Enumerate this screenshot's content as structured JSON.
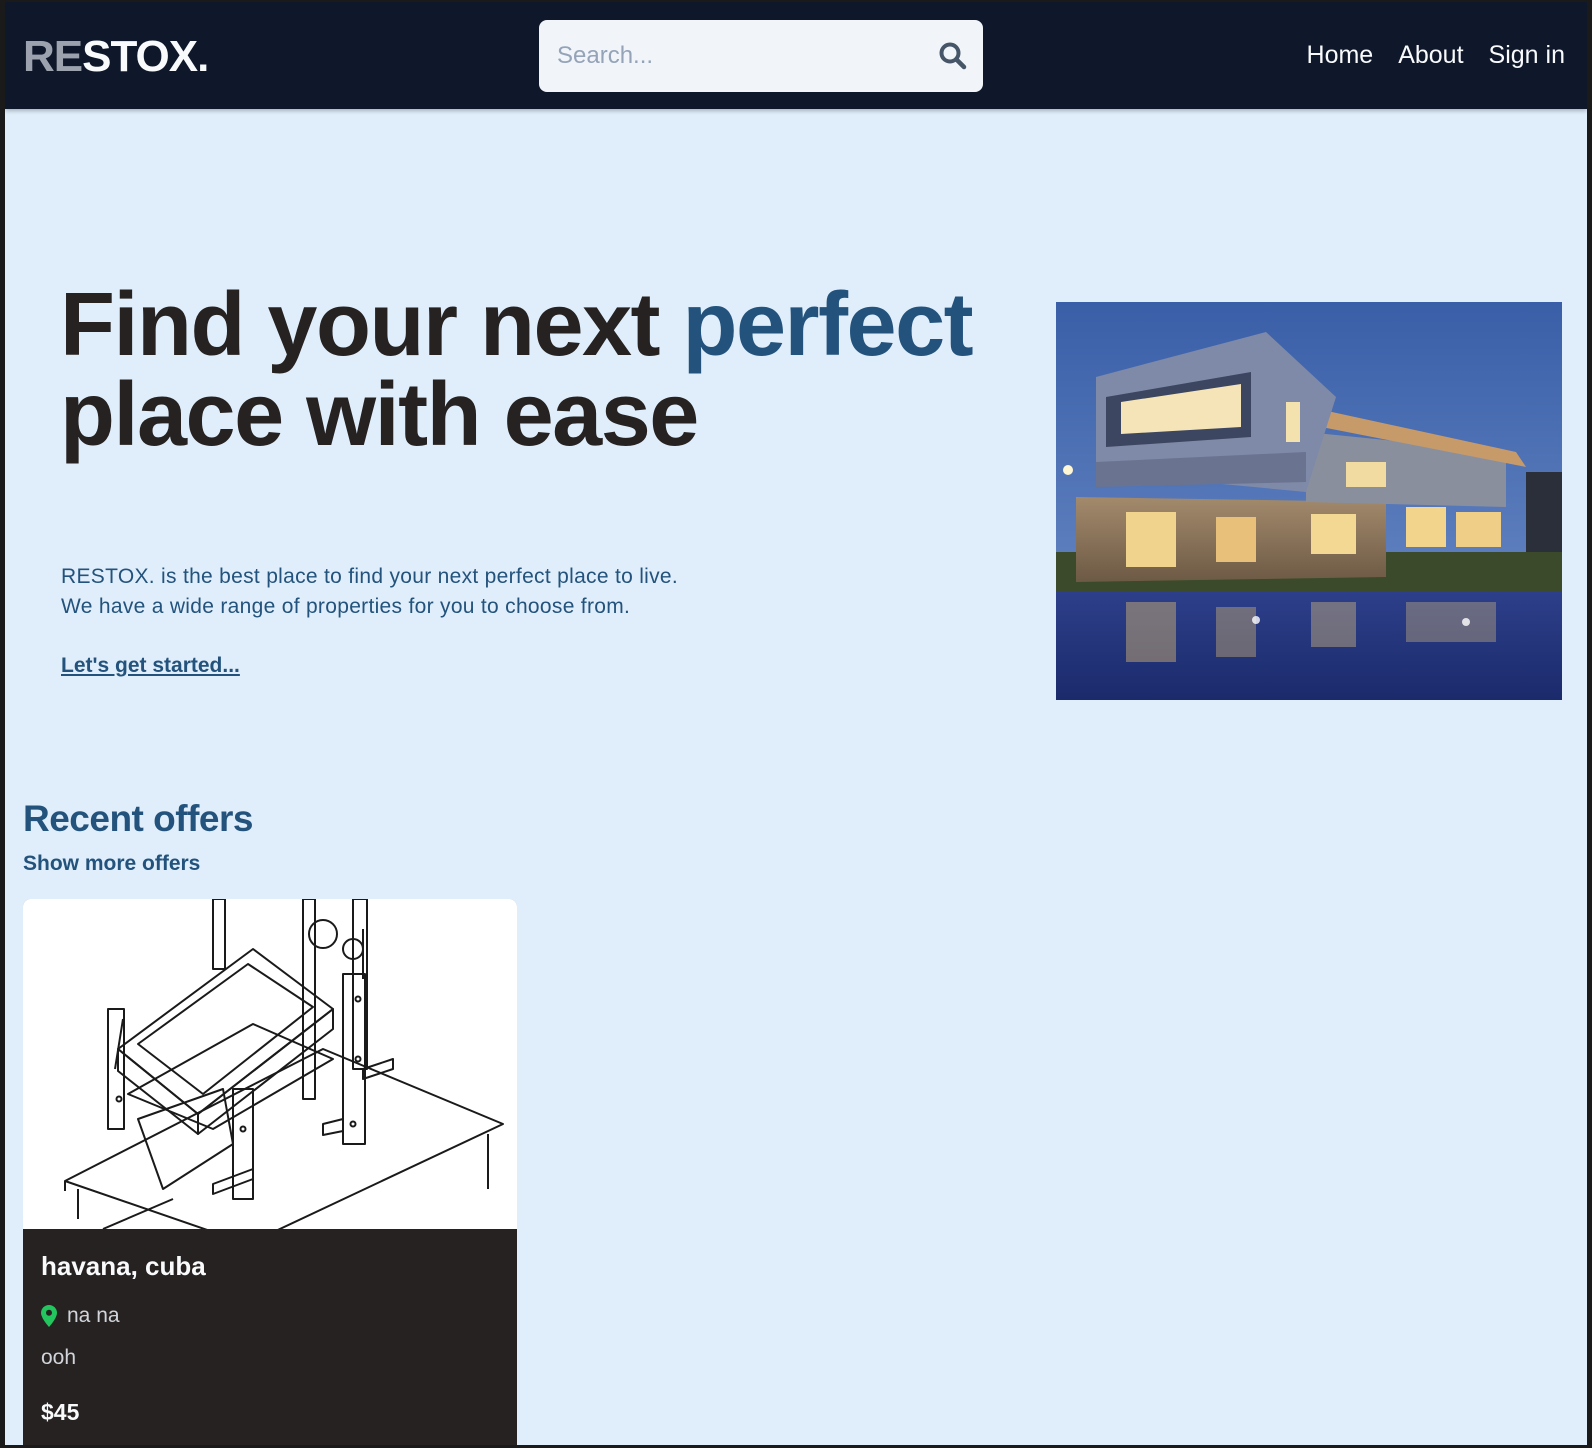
{
  "navbar": {
    "logo_prefix": "RE",
    "logo_suffix": "STOX.",
    "search_placeholder": "Search...",
    "search_value": "",
    "links": [
      "Home",
      "About",
      "Sign in"
    ]
  },
  "hero": {
    "title_part1": "Find your next ",
    "title_accent": "perfect",
    "title_part2": "place with ease",
    "description_line1": "RESTOX. is the best place to find your next perfect place to live.",
    "description_line2": "We have a wide range of properties for you to choose from.",
    "cta_label": "Let's get started..."
  },
  "recent_offers": {
    "title": "Recent offers",
    "show_more_label": "Show more offers",
    "listings": [
      {
        "title": "havana, cuba",
        "location": "na na",
        "description": "ooh",
        "price": "$45"
      }
    ]
  },
  "colors": {
    "navbar_bg": "#0f172a",
    "page_bg": "#e0eefb",
    "accent": "#23537c",
    "card_bg": "#262221",
    "pin": "#22c55e"
  },
  "icons": {
    "search": "search-icon",
    "location": "map-pin-icon"
  }
}
